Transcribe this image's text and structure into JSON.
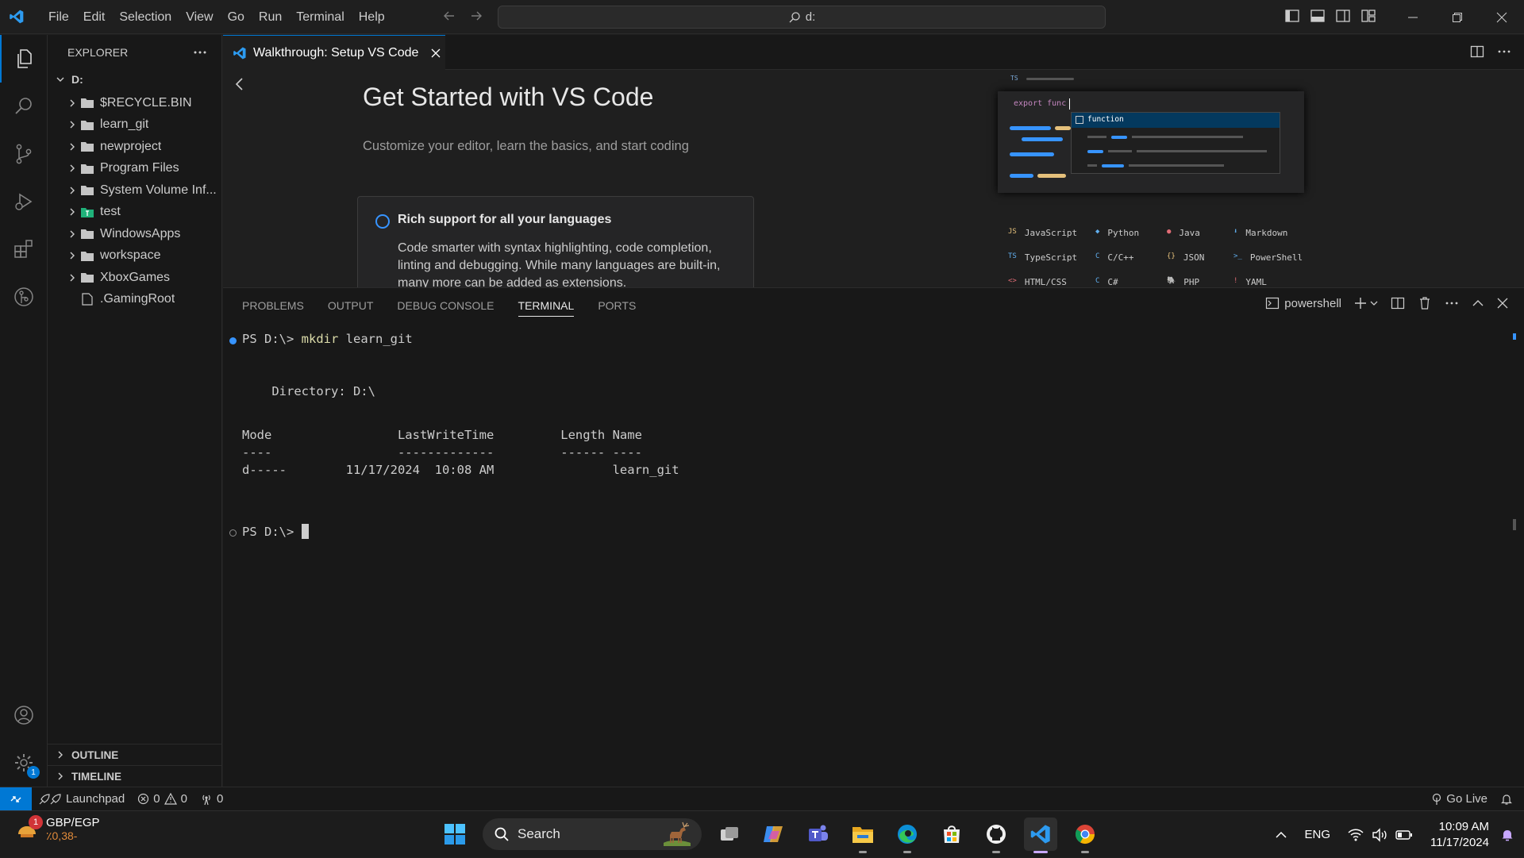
{
  "menu": [
    "File",
    "Edit",
    "Selection",
    "View",
    "Go",
    "Run",
    "Terminal",
    "Help"
  ],
  "command_center": "d:",
  "explorer": {
    "title": "EXPLORER",
    "root": "D:",
    "items": [
      {
        "name": "$RECYCLE.BIN",
        "type": "folder"
      },
      {
        "name": "learn_git",
        "type": "folder"
      },
      {
        "name": "newproject",
        "type": "folder"
      },
      {
        "name": "Program Files",
        "type": "folder"
      },
      {
        "name": "System Volume Inf...",
        "type": "folder"
      },
      {
        "name": "test",
        "type": "folder-test"
      },
      {
        "name": "WindowsApps",
        "type": "folder"
      },
      {
        "name": "workspace",
        "type": "folder"
      },
      {
        "name": "XboxGames",
        "type": "folder"
      },
      {
        "name": ".GamingRoot",
        "type": "file"
      }
    ],
    "outline": "OUTLINE",
    "timeline": "TIMELINE"
  },
  "settings_badge": "1",
  "tab": {
    "label": "Walkthrough: Setup VS Code"
  },
  "walkthrough": {
    "title": "Get Started with VS Code",
    "subtitle": "Customize your editor, learn the basics, and start coding",
    "card_title": "Rich support for all your languages",
    "card_body": "Code smarter with syntax highlighting, code completion, linting and debugging. While many languages are built-in, many more can be added as extensions."
  },
  "preview": {
    "file_tag": "TS",
    "code": "export func",
    "suggestion": "function",
    "languages": [
      [
        {
          "tag": "JS",
          "name": "JavaScript",
          "color": "#e5c07b"
        },
        {
          "tag": "◆",
          "name": "Python",
          "color": "#61afef"
        },
        {
          "tag": "●",
          "name": "Java",
          "color": "#e06c75"
        },
        {
          "tag": "⬇",
          "name": "Markdown",
          "color": "#61afef"
        }
      ],
      [
        {
          "tag": "TS",
          "name": "TypeScript",
          "color": "#61afef"
        },
        {
          "tag": "C",
          "name": "C/C++",
          "color": "#61afef"
        },
        {
          "tag": "{}",
          "name": "JSON",
          "color": "#e5c07b"
        },
        {
          "tag": ">_",
          "name": "PowerShell",
          "color": "#61afef"
        }
      ],
      [
        {
          "tag": "<>",
          "name": "HTML/CSS",
          "color": "#e06c75"
        },
        {
          "tag": "C",
          "name": "C#",
          "color": "#61afef"
        },
        {
          "tag": "🐘",
          "name": "PHP",
          "color": "#c678dd"
        },
        {
          "tag": "!",
          "name": "YAML",
          "color": "#e06c75"
        }
      ]
    ]
  },
  "panel": {
    "tabs": [
      "PROBLEMS",
      "OUTPUT",
      "DEBUG CONSOLE",
      "TERMINAL",
      "PORTS"
    ],
    "active_tab": "TERMINAL",
    "shell": "powershell"
  },
  "terminal": {
    "prompt1": "PS D:\\> ",
    "cmd1": "mkdir",
    "arg1": " learn_git",
    "directory": "    Directory: D:\\",
    "header": "Mode                 LastWriteTime         Length Name",
    "underline": "----                 -------------         ------ ----",
    "row": "d-----        11/17/2024  10:08 AM                learn_git",
    "prompt2": "PS D:\\> "
  },
  "statusbar": {
    "launchpad": "Launchpad",
    "errors": "0",
    "warnings": "0",
    "ports": "0",
    "golive": "Go Live"
  },
  "taskbar": {
    "weather_badge": "1",
    "ticker_name": "GBP/EGP",
    "ticker_value": "٪0,38-",
    "search": "Search",
    "lang": "ENG",
    "time": "10:09 AM",
    "date": "11/17/2024"
  }
}
